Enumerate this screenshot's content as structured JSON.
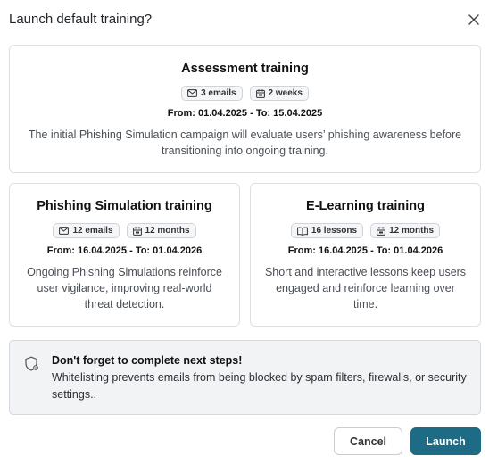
{
  "dialog": {
    "title": "Launch default training?",
    "close_icon": "close-icon"
  },
  "assessment": {
    "title": "Assessment training",
    "badges": [
      {
        "icon": "mail-icon",
        "label": "3 emails"
      },
      {
        "icon": "calendar-icon",
        "label": "2 weeks"
      }
    ],
    "dates": "From: 01.04.2025 - To: 15.04.2025",
    "description": "The initial Phishing Simulation campaign will evaluate users’ phishing awareness before transitioning into ongoing training."
  },
  "phishing": {
    "title": "Phishing Simulation training",
    "badges": [
      {
        "icon": "mail-icon",
        "label": "12 emails"
      },
      {
        "icon": "calendar-icon",
        "label": "12 months"
      }
    ],
    "dates": "From: 16.04.2025 - To: 01.04.2026",
    "description": "Ongoing Phishing Simulations reinforce user vigilance, improving real-world threat detection."
  },
  "elearning": {
    "title": "E-Learning training",
    "badges": [
      {
        "icon": "book-icon",
        "label": "16 lessons"
      },
      {
        "icon": "calendar-icon",
        "label": "12 months"
      }
    ],
    "dates": "From: 16.04.2025 - To: 01.04.2026",
    "description": "Short and interactive lessons keep users engaged and reinforce learning over time."
  },
  "notice": {
    "icon": "shield-settings-icon",
    "title": "Don't forget to complete next steps!",
    "text": "Whitelisting prevents emails from being blocked by spam filters, firewalls, or security settings.."
  },
  "footer": {
    "cancel_label": "Cancel",
    "launch_label": "Launch"
  },
  "colors": {
    "primary": "#1d6b84",
    "border": "#dcdfe3",
    "notice_bg": "#f1f3f5"
  }
}
